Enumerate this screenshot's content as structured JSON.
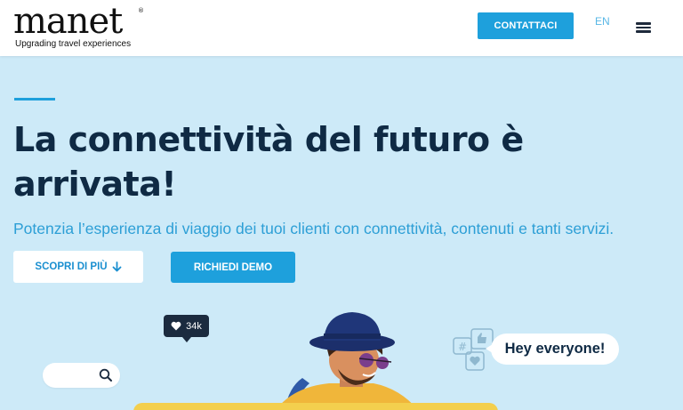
{
  "header": {
    "logo_text": "manet",
    "logo_reg": "®",
    "logo_tagline": "Upgrading travel experiences",
    "contact_label": "CONTATTACI",
    "lang_label": "EN"
  },
  "hero": {
    "title": "La connettività del futuro è arrivata!",
    "subtitle": "Potenzia l’esperienza di viaggio dei tuoi clienti con connettività, contenuti e tanti servizi.",
    "discover_label": "SCOPRI DI PIÙ",
    "demo_label": "RICHIEDI DEMO"
  },
  "illustration": {
    "like_count": "34k",
    "bubble_text": "Hey everyone!"
  },
  "colors": {
    "accent": "#1ea0dc",
    "hero_bg": "#cdeaf8",
    "title": "#0f2a44",
    "yellow": "#f3cf4e"
  }
}
